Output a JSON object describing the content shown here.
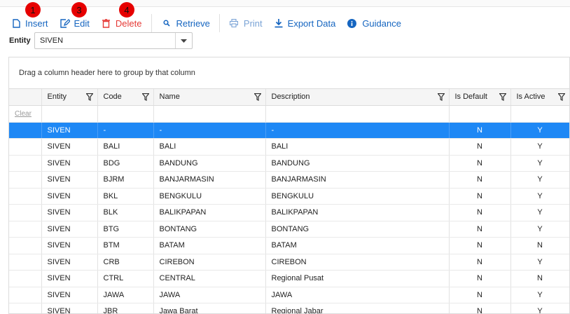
{
  "toolbar": {
    "insert_label": "Insert",
    "edit_label": "Edit",
    "delete_label": "Delete",
    "retrieve_label": "Retrieve",
    "print_label": "Print",
    "export_label": "Export Data",
    "guidance_label": "Guidance",
    "badges": [
      "1",
      "3",
      "4"
    ]
  },
  "entity_filter": {
    "label": "Entity",
    "value": "SIVEN"
  },
  "grid": {
    "group_panel_text": "Drag a column header here to group by that column",
    "clear_label": "Clear",
    "columns": [
      "Entity",
      "Code",
      "Name",
      "Description",
      "Is Default",
      "Is Active"
    ],
    "rows": [
      [
        "SIVEN",
        "-",
        "-",
        "-",
        "N",
        "Y"
      ],
      [
        "SIVEN",
        "BALI",
        "BALI",
        "BALI",
        "N",
        "Y"
      ],
      [
        "SIVEN",
        "BDG",
        "BANDUNG",
        "BANDUNG",
        "N",
        "Y"
      ],
      [
        "SIVEN",
        "BJRM",
        "BANJARMASIN",
        "BANJARMASIN",
        "N",
        "Y"
      ],
      [
        "SIVEN",
        "BKL",
        "BENGKULU",
        "BENGKULU",
        "N",
        "Y"
      ],
      [
        "SIVEN",
        "BLK",
        "BALIKPAPAN",
        "BALIKPAPAN",
        "N",
        "Y"
      ],
      [
        "SIVEN",
        "BTG",
        "BONTANG",
        "BONTANG",
        "N",
        "Y"
      ],
      [
        "SIVEN",
        "BTM",
        "BATAM",
        "BATAM",
        "N",
        "N"
      ],
      [
        "SIVEN",
        "CRB",
        "CIREBON",
        "CIREBON",
        "N",
        "Y"
      ],
      [
        "SIVEN",
        "CTRL",
        "CENTRAL",
        "Regional Pusat",
        "N",
        "N"
      ],
      [
        "SIVEN",
        "JAWA",
        "JAWA",
        "JAWA",
        "N",
        "Y"
      ],
      [
        "SIVEN",
        "JBR",
        "Jawa Barat",
        "Regional Jabar",
        "N",
        "Y"
      ]
    ]
  },
  "colors": {
    "accent": "#1565c0",
    "delete": "#e53935",
    "selected_row": "#1e88f5",
    "badge": "#e60000"
  }
}
